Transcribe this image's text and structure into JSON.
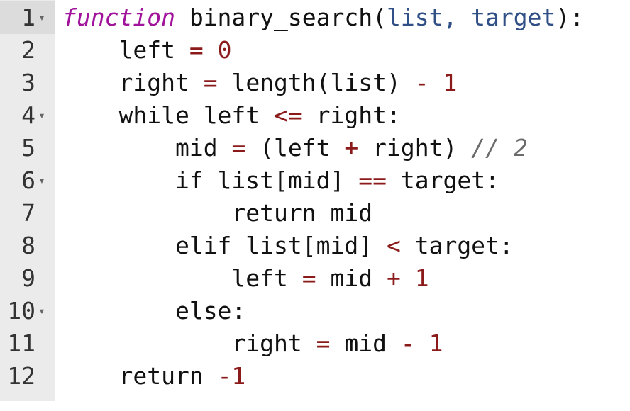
{
  "editor": {
    "lines": [
      {
        "number": "1",
        "fold": true,
        "indent": "",
        "tokens": [
          {
            "t": "function",
            "c": "kw-fn"
          },
          {
            "t": " binary_search(",
            "c": "plain"
          },
          {
            "t": "list, target",
            "c": "param"
          },
          {
            "t": "):",
            "c": "plain"
          }
        ]
      },
      {
        "number": "2",
        "fold": false,
        "indent": "    ",
        "tokens": [
          {
            "t": "left ",
            "c": "plain"
          },
          {
            "t": "=",
            "c": "op"
          },
          {
            "t": " ",
            "c": "plain"
          },
          {
            "t": "0",
            "c": "num"
          }
        ]
      },
      {
        "number": "3",
        "fold": false,
        "indent": "    ",
        "tokens": [
          {
            "t": "right ",
            "c": "plain"
          },
          {
            "t": "=",
            "c": "op"
          },
          {
            "t": " length(list) ",
            "c": "plain"
          },
          {
            "t": "-",
            "c": "op"
          },
          {
            "t": " ",
            "c": "plain"
          },
          {
            "t": "1",
            "c": "num"
          }
        ]
      },
      {
        "number": "4",
        "fold": true,
        "indent": "    ",
        "tokens": [
          {
            "t": "while left ",
            "c": "plain"
          },
          {
            "t": "<=",
            "c": "op"
          },
          {
            "t": " right:",
            "c": "plain"
          }
        ]
      },
      {
        "number": "5",
        "fold": false,
        "indent": "        ",
        "tokens": [
          {
            "t": "mid ",
            "c": "plain"
          },
          {
            "t": "=",
            "c": "op"
          },
          {
            "t": " (left ",
            "c": "plain"
          },
          {
            "t": "+",
            "c": "op"
          },
          {
            "t": " right) ",
            "c": "plain"
          },
          {
            "t": "// 2",
            "c": "cmt"
          }
        ]
      },
      {
        "number": "6",
        "fold": true,
        "indent": "        ",
        "tokens": [
          {
            "t": "if list[mid] ",
            "c": "plain"
          },
          {
            "t": "==",
            "c": "op"
          },
          {
            "t": " target:",
            "c": "plain"
          }
        ]
      },
      {
        "number": "7",
        "fold": false,
        "indent": "            ",
        "tokens": [
          {
            "t": "return mid",
            "c": "plain"
          }
        ]
      },
      {
        "number": "8",
        "fold": false,
        "indent": "        ",
        "tokens": [
          {
            "t": "elif list[mid] ",
            "c": "plain"
          },
          {
            "t": "<",
            "c": "op"
          },
          {
            "t": " target:",
            "c": "plain"
          }
        ]
      },
      {
        "number": "9",
        "fold": false,
        "indent": "            ",
        "tokens": [
          {
            "t": "left ",
            "c": "plain"
          },
          {
            "t": "=",
            "c": "op"
          },
          {
            "t": " mid ",
            "c": "plain"
          },
          {
            "t": "+",
            "c": "op"
          },
          {
            "t": " ",
            "c": "plain"
          },
          {
            "t": "1",
            "c": "num"
          }
        ]
      },
      {
        "number": "10",
        "fold": true,
        "indent": "        ",
        "tokens": [
          {
            "t": "else:",
            "c": "plain"
          }
        ]
      },
      {
        "number": "11",
        "fold": false,
        "indent": "            ",
        "tokens": [
          {
            "t": "right ",
            "c": "plain"
          },
          {
            "t": "=",
            "c": "op"
          },
          {
            "t": " mid ",
            "c": "plain"
          },
          {
            "t": "-",
            "c": "op"
          },
          {
            "t": " ",
            "c": "plain"
          },
          {
            "t": "1",
            "c": "num"
          }
        ]
      },
      {
        "number": "12",
        "fold": false,
        "indent": "    ",
        "tokens": [
          {
            "t": "return ",
            "c": "plain"
          },
          {
            "t": "-1",
            "c": "num"
          }
        ]
      }
    ],
    "fold_glyph": "▾",
    "colors": {
      "keyword": "#a0139a",
      "parameter": "#2f4f86",
      "number": "#8b1a1a",
      "comment": "#6b6b6b",
      "gutter": "#ebebeb"
    }
  }
}
